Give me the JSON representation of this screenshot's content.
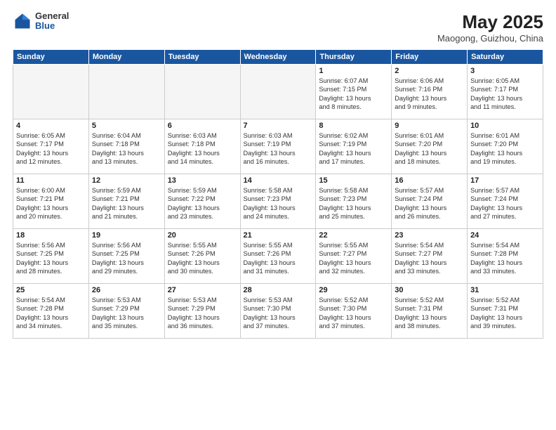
{
  "header": {
    "logo": {
      "general": "General",
      "blue": "Blue"
    },
    "title": "May 2025",
    "location": "Maogong, Guizhou, China"
  },
  "weekdays": [
    "Sunday",
    "Monday",
    "Tuesday",
    "Wednesday",
    "Thursday",
    "Friday",
    "Saturday"
  ],
  "weeks": [
    [
      {
        "day": "",
        "empty": true,
        "info": ""
      },
      {
        "day": "",
        "empty": true,
        "info": ""
      },
      {
        "day": "",
        "empty": true,
        "info": ""
      },
      {
        "day": "",
        "empty": true,
        "info": ""
      },
      {
        "day": "1",
        "empty": false,
        "info": "Sunrise: 6:07 AM\nSunset: 7:15 PM\nDaylight: 13 hours\nand 8 minutes."
      },
      {
        "day": "2",
        "empty": false,
        "info": "Sunrise: 6:06 AM\nSunset: 7:16 PM\nDaylight: 13 hours\nand 9 minutes."
      },
      {
        "day": "3",
        "empty": false,
        "info": "Sunrise: 6:05 AM\nSunset: 7:17 PM\nDaylight: 13 hours\nand 11 minutes."
      }
    ],
    [
      {
        "day": "4",
        "empty": false,
        "info": "Sunrise: 6:05 AM\nSunset: 7:17 PM\nDaylight: 13 hours\nand 12 minutes."
      },
      {
        "day": "5",
        "empty": false,
        "info": "Sunrise: 6:04 AM\nSunset: 7:18 PM\nDaylight: 13 hours\nand 13 minutes."
      },
      {
        "day": "6",
        "empty": false,
        "info": "Sunrise: 6:03 AM\nSunset: 7:18 PM\nDaylight: 13 hours\nand 14 minutes."
      },
      {
        "day": "7",
        "empty": false,
        "info": "Sunrise: 6:03 AM\nSunset: 7:19 PM\nDaylight: 13 hours\nand 16 minutes."
      },
      {
        "day": "8",
        "empty": false,
        "info": "Sunrise: 6:02 AM\nSunset: 7:19 PM\nDaylight: 13 hours\nand 17 minutes."
      },
      {
        "day": "9",
        "empty": false,
        "info": "Sunrise: 6:01 AM\nSunset: 7:20 PM\nDaylight: 13 hours\nand 18 minutes."
      },
      {
        "day": "10",
        "empty": false,
        "info": "Sunrise: 6:01 AM\nSunset: 7:20 PM\nDaylight: 13 hours\nand 19 minutes."
      }
    ],
    [
      {
        "day": "11",
        "empty": false,
        "info": "Sunrise: 6:00 AM\nSunset: 7:21 PM\nDaylight: 13 hours\nand 20 minutes."
      },
      {
        "day": "12",
        "empty": false,
        "info": "Sunrise: 5:59 AM\nSunset: 7:21 PM\nDaylight: 13 hours\nand 21 minutes."
      },
      {
        "day": "13",
        "empty": false,
        "info": "Sunrise: 5:59 AM\nSunset: 7:22 PM\nDaylight: 13 hours\nand 23 minutes."
      },
      {
        "day": "14",
        "empty": false,
        "info": "Sunrise: 5:58 AM\nSunset: 7:23 PM\nDaylight: 13 hours\nand 24 minutes."
      },
      {
        "day": "15",
        "empty": false,
        "info": "Sunrise: 5:58 AM\nSunset: 7:23 PM\nDaylight: 13 hours\nand 25 minutes."
      },
      {
        "day": "16",
        "empty": false,
        "info": "Sunrise: 5:57 AM\nSunset: 7:24 PM\nDaylight: 13 hours\nand 26 minutes."
      },
      {
        "day": "17",
        "empty": false,
        "info": "Sunrise: 5:57 AM\nSunset: 7:24 PM\nDaylight: 13 hours\nand 27 minutes."
      }
    ],
    [
      {
        "day": "18",
        "empty": false,
        "info": "Sunrise: 5:56 AM\nSunset: 7:25 PM\nDaylight: 13 hours\nand 28 minutes."
      },
      {
        "day": "19",
        "empty": false,
        "info": "Sunrise: 5:56 AM\nSunset: 7:25 PM\nDaylight: 13 hours\nand 29 minutes."
      },
      {
        "day": "20",
        "empty": false,
        "info": "Sunrise: 5:55 AM\nSunset: 7:26 PM\nDaylight: 13 hours\nand 30 minutes."
      },
      {
        "day": "21",
        "empty": false,
        "info": "Sunrise: 5:55 AM\nSunset: 7:26 PM\nDaylight: 13 hours\nand 31 minutes."
      },
      {
        "day": "22",
        "empty": false,
        "info": "Sunrise: 5:55 AM\nSunset: 7:27 PM\nDaylight: 13 hours\nand 32 minutes."
      },
      {
        "day": "23",
        "empty": false,
        "info": "Sunrise: 5:54 AM\nSunset: 7:27 PM\nDaylight: 13 hours\nand 33 minutes."
      },
      {
        "day": "24",
        "empty": false,
        "info": "Sunrise: 5:54 AM\nSunset: 7:28 PM\nDaylight: 13 hours\nand 33 minutes."
      }
    ],
    [
      {
        "day": "25",
        "empty": false,
        "info": "Sunrise: 5:54 AM\nSunset: 7:28 PM\nDaylight: 13 hours\nand 34 minutes."
      },
      {
        "day": "26",
        "empty": false,
        "info": "Sunrise: 5:53 AM\nSunset: 7:29 PM\nDaylight: 13 hours\nand 35 minutes."
      },
      {
        "day": "27",
        "empty": false,
        "info": "Sunrise: 5:53 AM\nSunset: 7:29 PM\nDaylight: 13 hours\nand 36 minutes."
      },
      {
        "day": "28",
        "empty": false,
        "info": "Sunrise: 5:53 AM\nSunset: 7:30 PM\nDaylight: 13 hours\nand 37 minutes."
      },
      {
        "day": "29",
        "empty": false,
        "info": "Sunrise: 5:52 AM\nSunset: 7:30 PM\nDaylight: 13 hours\nand 37 minutes."
      },
      {
        "day": "30",
        "empty": false,
        "info": "Sunrise: 5:52 AM\nSunset: 7:31 PM\nDaylight: 13 hours\nand 38 minutes."
      },
      {
        "day": "31",
        "empty": false,
        "info": "Sunrise: 5:52 AM\nSunset: 7:31 PM\nDaylight: 13 hours\nand 39 minutes."
      }
    ]
  ]
}
